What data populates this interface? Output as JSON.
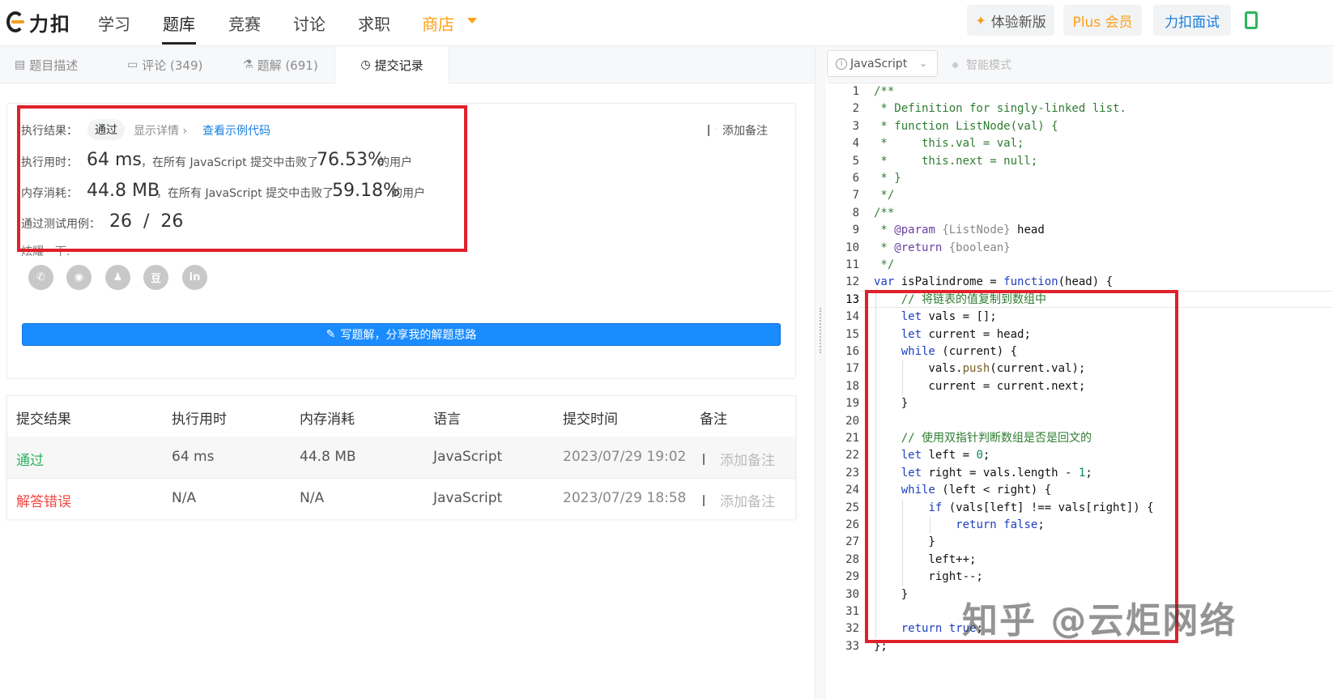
{
  "nav": {
    "logo_text": "力扣",
    "items": [
      "学习",
      "题库",
      "竞赛",
      "讨论",
      "求职",
      "商店"
    ],
    "btn_new": "体验新版",
    "btn_plus": "Plus 会员",
    "btn_interview": "力扣面试"
  },
  "tabs": [
    {
      "label": "题目描述",
      "icon": "description-icon"
    },
    {
      "label": "评论 (349)",
      "icon": "comment-icon"
    },
    {
      "label": "题解 (691)",
      "icon": "flask-icon"
    },
    {
      "label": "提交记录",
      "icon": "clock-icon"
    }
  ],
  "result": {
    "status_label": "执行结果：",
    "status": "通过",
    "show_detail": "显示详情 ›",
    "view_example": "查看示例代码",
    "add_note": "添加备注",
    "time_label": "执行用时：",
    "time_value": "64 ms",
    "time_text": "，在所有 JavaScript 提交中击败了",
    "time_percent": "76.53%",
    "users": "的用户",
    "mem_label": "内存消耗：",
    "mem_value": "44.8 MB",
    "mem_text": "，在所有 JavaScript 提交中击败了",
    "mem_percent": "59.18%",
    "cases_label": "通过测试用例：",
    "cases_value": "26  /  26",
    "share_label": "炫耀一下:",
    "share_icons": [
      "wechat-icon",
      "weibo-icon",
      "qq-icon",
      "douban-icon",
      "linkedin-icon"
    ],
    "share_glyphs": [
      "✆",
      "◉",
      "♟",
      "豆",
      "in"
    ],
    "write_solution": "写题解，分享我的解题思路"
  },
  "submissions": {
    "headers": [
      "提交结果",
      "执行用时",
      "内存消耗",
      "语言",
      "提交时间",
      "备注"
    ],
    "rows": [
      {
        "result": "通过",
        "time": "64 ms",
        "memory": "44.8 MB",
        "lang": "JavaScript",
        "submitted": "2023/07/29 19:02",
        "note": "添加备注"
      },
      {
        "result": "解答错误",
        "time": "N/A",
        "memory": "N/A",
        "lang": "JavaScript",
        "submitted": "2023/07/29 18:58",
        "note": "添加备注"
      }
    ]
  },
  "editor": {
    "language": "JavaScript",
    "smart_mode": "智能模式",
    "current_line": 13,
    "lines": [
      "/**",
      " * Definition for singly-linked list.",
      " * function ListNode(val) {",
      " *     this.val = val;",
      " *     this.next = null;",
      " * }",
      " */",
      "/**",
      " * @param {ListNode} head",
      " * @return {boolean}",
      " */",
      "var isPalindrome = function(head) {",
      "    // 将链表的值复制到数组中",
      "    let vals = [];",
      "    let current = head;",
      "    while (current) {",
      "        vals.push(current.val);",
      "        current = current.next;",
      "    }",
      "",
      "    // 使用双指针判断数组是否是回文的",
      "    let left = 0;",
      "    let right = vals.length - 1;",
      "    while (left < right) {",
      "        if (vals[left] !== vals[right]) {",
      "            return false;",
      "        }",
      "        left++;",
      "        right--;",
      "    }",
      "",
      "    return true;",
      "};"
    ]
  },
  "watermark": "知乎 @云炬网络",
  "colors": {
    "accent_blue": "#1a8cff",
    "pass_green": "#2db55d",
    "error_red": "#ef4743",
    "shop_orange": "#ffa116",
    "annotation_red": "#e0202a"
  }
}
